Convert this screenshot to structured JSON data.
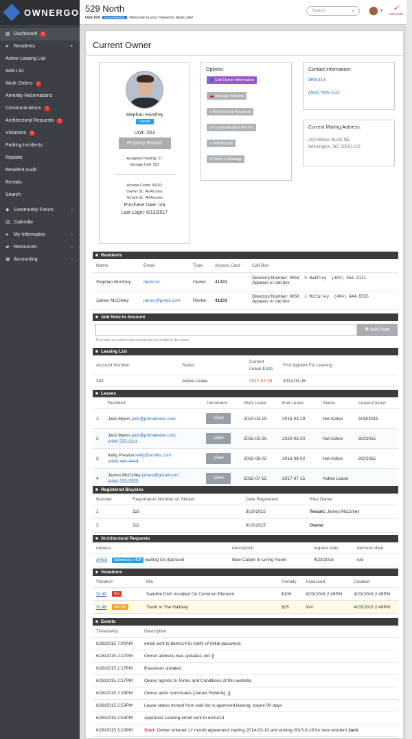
{
  "app": {
    "logo": "OWNERGO"
  },
  "sidebar": {
    "items": [
      {
        "label": "Dashboard",
        "badge": "5",
        "icon": "dashboard-icon"
      },
      {
        "label": "Residents",
        "icon": "user-icon",
        "chevron": "▾"
      },
      {
        "label": "Active Leasing List"
      },
      {
        "label": "Wait List"
      },
      {
        "label": "Work Orders",
        "badge": "3"
      },
      {
        "label": "Amenity Reservations"
      },
      {
        "label": "Communications",
        "badge": "7"
      },
      {
        "label": "Architectural Requests",
        "badge": "1"
      },
      {
        "label": "Violations",
        "badge": "5"
      },
      {
        "label": "Parking Incidents"
      },
      {
        "label": "Reports"
      },
      {
        "label": "Resident Audit"
      },
      {
        "label": "Rentals"
      },
      {
        "label": "Search"
      },
      {
        "label": "Community Forum",
        "icon": "chat-icon",
        "chevron": "›"
      },
      {
        "label": "Calendar",
        "icon": "calendar-icon"
      },
      {
        "label": "My Information",
        "icon": "user-icon",
        "chevron": "›"
      },
      {
        "label": "Resources",
        "icon": "folder-icon",
        "chevron": "›"
      },
      {
        "label": "Accounting",
        "icon": "accounting-icon",
        "chevron": "›"
      }
    ]
  },
  "topbar": {
    "title": "529 North",
    "unit": "Unit 204",
    "board_badge": "Board Member",
    "welcome": "Welcome to your OwnerGo demo site!",
    "search_placeholder": "Search",
    "brand_text": "529 North"
  },
  "page": {
    "title": "Current Owner"
  },
  "owner": {
    "name": "Stephan Humfrey",
    "tag": "Owner",
    "unit": "Unit: 203",
    "property_record_btn": "Property Record",
    "parking": "Assigned Parking: 27",
    "storage": "Storage Unit: 523",
    "access_cards": "Access Cards: 41101",
    "owner_sl": "Owner SL: All Access",
    "tenant_sl": "Tenant SL: All Access",
    "purchase_date": "Purchase Date: n/a",
    "last_login": "Last Login: 6/12/2017"
  },
  "options": {
    "label": "Options:",
    "buttons": [
      "Edit Owner Information",
      "Manage Vehicles",
      "Architectural Requests",
      "Communication Record",
      "Add Bicycle",
      "Send a Message"
    ]
  },
  "contact": {
    "label": "Contact Information:",
    "username": "demo14",
    "phone": "(404) 555-1111"
  },
  "mailing": {
    "label": "Current Mailing Address:",
    "line1": "203 Willow BLVD NE",
    "line2": "Wilmington, NC 20001 US"
  },
  "residents": {
    "title": "Residents",
    "headers": [
      "Name",
      "Email",
      "Type",
      "Access Card",
      "Call Box"
    ],
    "rows": [
      {
        "name": "Stephan Humfrey",
        "email": "demo14",
        "type": "Owner",
        "card": "41101",
        "dir": "Directory Number:",
        "dirnum": "0054",
        "callname": "S Humfrey",
        "callphone": "(404) 555-1111",
        "note": "Appears in call box"
      },
      {
        "name": "James McCinley",
        "email": "james@gmail.com",
        "type": "Renter",
        "card": "41101",
        "dir": "Directory Number:",
        "dirnum": "0056",
        "callname": "J McCinley",
        "callphone": "(404) 444-5555",
        "note": "Appears in call box"
      }
    ]
  },
  "add_note": {
    "title": "Add Note to Account",
    "button": "Add Note",
    "hint": "The notes you add to this account are not visible to the owner."
  },
  "leasing_list": {
    "title": "Leasing List",
    "headers": [
      "Account Number",
      "Status",
      "Current",
      "Lease Ends",
      "First Applied For Leasing"
    ],
    "row": {
      "account": "332",
      "status": "Active Lease",
      "ends": "2017-07-15",
      "applied": "2013-03-26"
    }
  },
  "leases": {
    "title": "Leases",
    "headers": [
      "Resident",
      "Document",
      "Start Lease",
      "End Lease",
      "Status",
      "Lease Closed"
    ],
    "view_label": "View",
    "rows": [
      {
        "n": "1",
        "name": "Jack Myers",
        "email": "jack@primalease.com",
        "phone": "",
        "start": "2014-03-19",
        "end": "2015-03-19",
        "status": "Not Active",
        "closed": "6/28/2015"
      },
      {
        "n": "2",
        "name": "Jack Myers",
        "email": "jack@primalease.com",
        "phone": "(404) 555-1111",
        "start": "2015-03-20",
        "end": "2020-03-20",
        "status": "Not Active",
        "closed": "8/2/2015"
      },
      {
        "n": "3",
        "name": "Kelly Preston",
        "email": "kelly@smiles.com",
        "phone": "(404) 444-4444",
        "start": "2015-08-02",
        "end": "2016-08-02",
        "status": "Not Active",
        "closed": "8/2/2015"
      },
      {
        "n": "4",
        "name": "James McCinley",
        "email": "james@gmail.com",
        "phone": "(404) 555-5555",
        "start": "2015-07-15",
        "end": "2017-07-15",
        "status": "Active Lease",
        "closed": ""
      }
    ]
  },
  "bicycles": {
    "title": "Registered Bicycles",
    "headers": [
      "Number",
      "Registration Number on Sticker",
      "Date Registered",
      "Bike Owner"
    ],
    "rows": [
      {
        "n": "1",
        "reg": "110",
        "date": "8/10/2015",
        "owner_b": "Tenant:",
        "owner": "James McCinley"
      },
      {
        "n": "2",
        "reg": "111",
        "date": "8/10/2015",
        "owner_b": "Owner",
        "owner": ""
      }
    ]
  },
  "arch": {
    "title": "Architectural Requests",
    "headers": [
      "request",
      "description",
      "request date",
      "decision date"
    ],
    "row": {
      "id": "AR55",
      "badge": "Submitted to HOA",
      "waiting": "waiting for Approval",
      "desc": "New Carpet In Living Room",
      "date": "4/23/2016",
      "decision": "n/a"
    }
  },
  "violations": {
    "title": "Violations",
    "headers": [
      "Violation",
      "title",
      "Penalty",
      "Assessed",
      "Created"
    ],
    "rows": [
      {
        "id": "VL49",
        "badge": "fine",
        "title": "Satellite Dish Installed On Common Element",
        "penalty": "$100",
        "assessed": "4/23/2016 2:49PM",
        "created": "4/23/2016 2:49PM"
      },
      {
        "id": "VL48",
        "badge": "warning",
        "title": "Trash In The Hallway",
        "penalty": "$25",
        "assessed": "N/A",
        "created": "4/23/2016 2:48PM"
      }
    ]
  },
  "events": {
    "title": "Events",
    "headers": [
      "Timestamp",
      "Description"
    ],
    "rows": [
      {
        "ts": "6/28/2015 7:00AM",
        "desc": "email sent to demo14 to notify of initial password."
      },
      {
        "ts": "6/28/2015 2:17PM",
        "desc": "Owner address was updated, old: []"
      },
      {
        "ts": "6/28/2015 2:17PM",
        "desc": "Password updated"
      },
      {
        "ts": "6/28/2015 2:17PM",
        "desc": "Owner agrees to Terms and Conditions of this website."
      },
      {
        "ts": "6/28/2015 2:18PM",
        "desc": "Owner adds roommates [James Roberts], []."
      },
      {
        "ts": "6/28/2015 2:53PM",
        "desc": "Lease status moved from wait list to approved leasing, expire 90 days"
      },
      {
        "ts": "6/28/2015 2:53PM",
        "desc": "Approved Leasing email sent to demo14"
      },
      {
        "ts": "6/28/2015 3:10PM",
        "start": "Start:",
        "desc": "Owner entered 12 month agreement starting 2014-03-19 and ending 2015-3-19 for new resident",
        "who": "Jack"
      }
    ]
  }
}
